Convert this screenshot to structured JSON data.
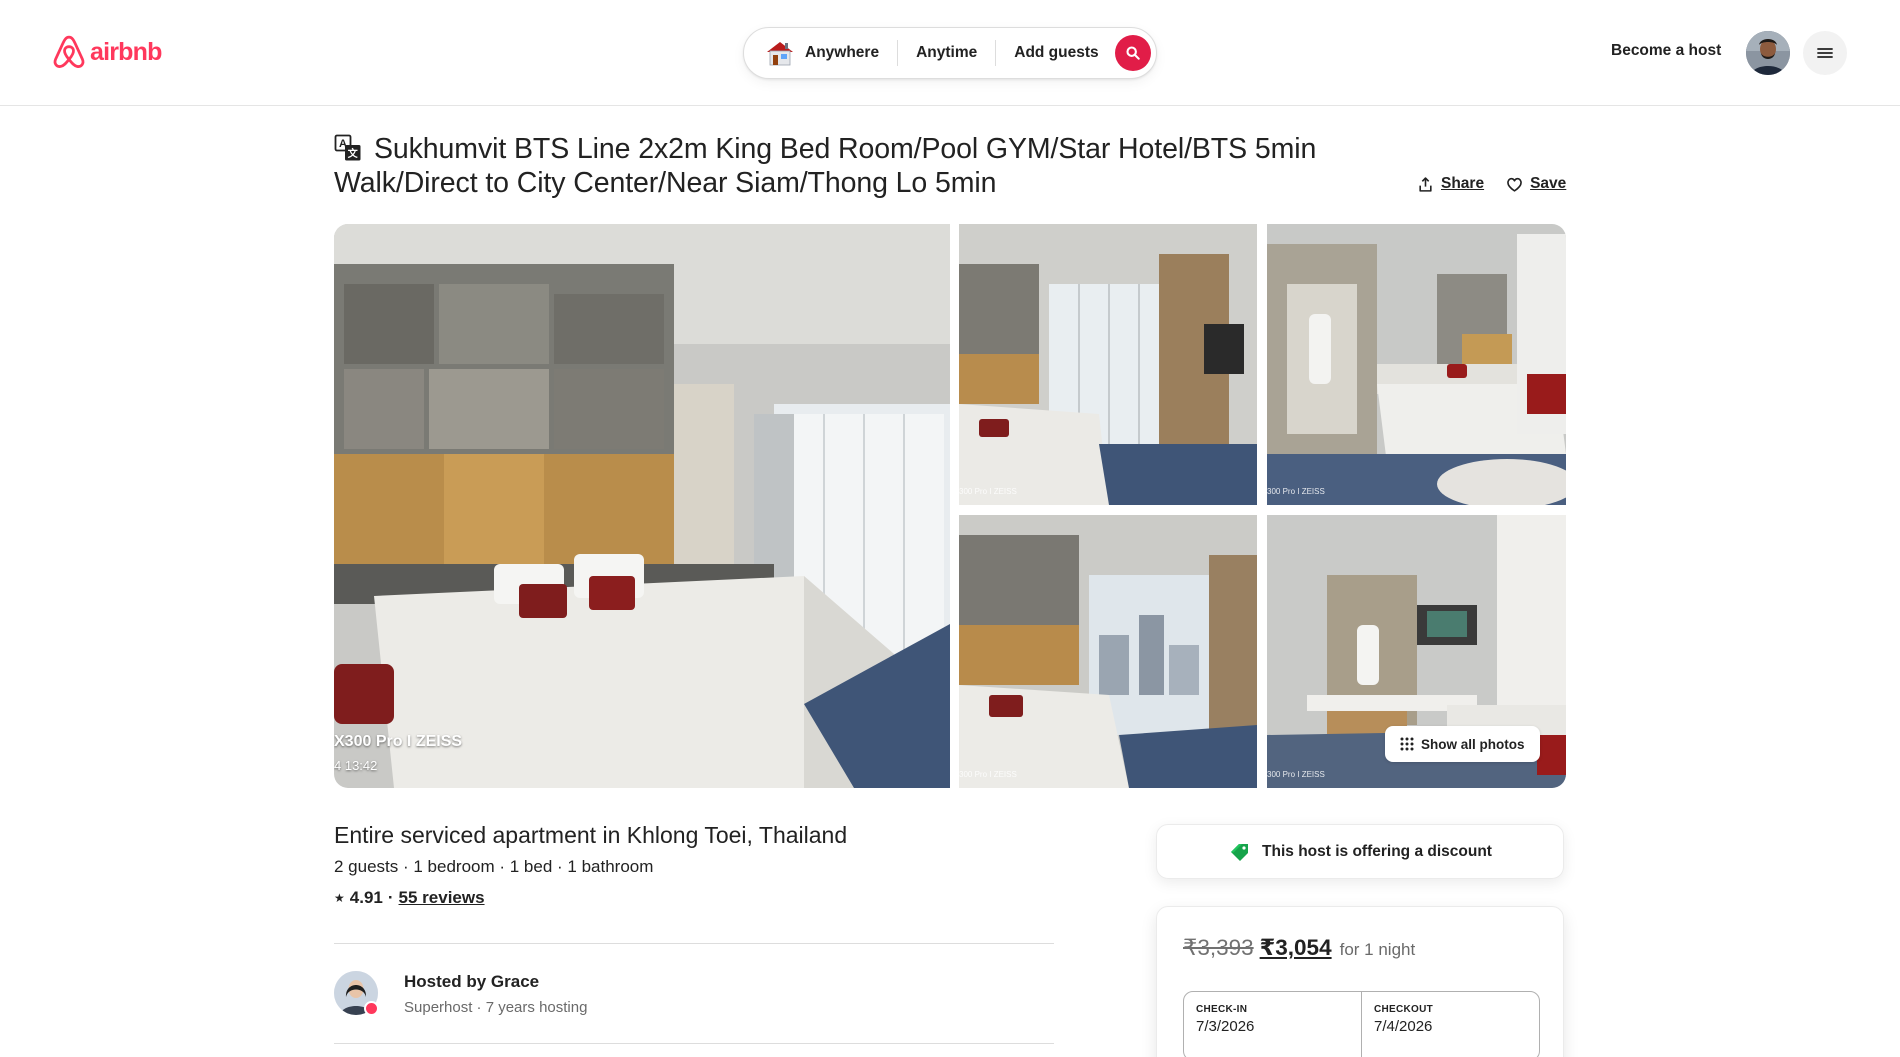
{
  "header": {
    "logo_text": "airbnb",
    "search": {
      "anywhere": "Anywhere",
      "anytime": "Anytime",
      "guests": "Add guests"
    },
    "become_host": "Become a host"
  },
  "listing": {
    "title": "Sukhumvit BTS Line 2x2m King Bed Room/Pool GYM/Star Hotel/BTS 5min Walk/Direct to City Center/Near Siam/Thong Lo 5min",
    "share_label": "Share",
    "save_label": "Save",
    "subtitle": "Entire serviced apartment in Khlong Toei, Thailand",
    "details": "2 guests · 1 bedroom · 1 bed · 1 bathroom",
    "rating": "4.91",
    "rating_sep": "·",
    "reviews": "55 reviews"
  },
  "gallery": {
    "watermark_main": "X300 Pro I ZEISS",
    "watermark_main_time": "4 13:42",
    "watermark_small": "300 Pro I ZEISS",
    "show_all": "Show all photos"
  },
  "host": {
    "hosted_by": "Hosted by Grace",
    "meta": "Superhost · 7 years hosting"
  },
  "discount": {
    "text": "This host is offering a discount"
  },
  "booking": {
    "old_price": "₹3,393",
    "new_price": "₹3,054",
    "per_night": "for 1 night",
    "checkin_label": "CHECK-IN",
    "checkin_value": "7/3/2026",
    "checkout_label": "CHECKOUT",
    "checkout_value": "7/4/2026"
  },
  "colors": {
    "brand": "#ff385c",
    "search_button": "#e11d48",
    "discount_tag": "#16a34a"
  },
  "icons": {
    "logo": "airbnb-logo-icon",
    "translate": "translate-icon",
    "share": "share-icon",
    "save": "heart-icon",
    "search": "search-icon",
    "menu": "hamburger-menu-icon",
    "grid": "grid-dots-icon",
    "tag": "price-tag-icon",
    "house": "house-icon"
  }
}
